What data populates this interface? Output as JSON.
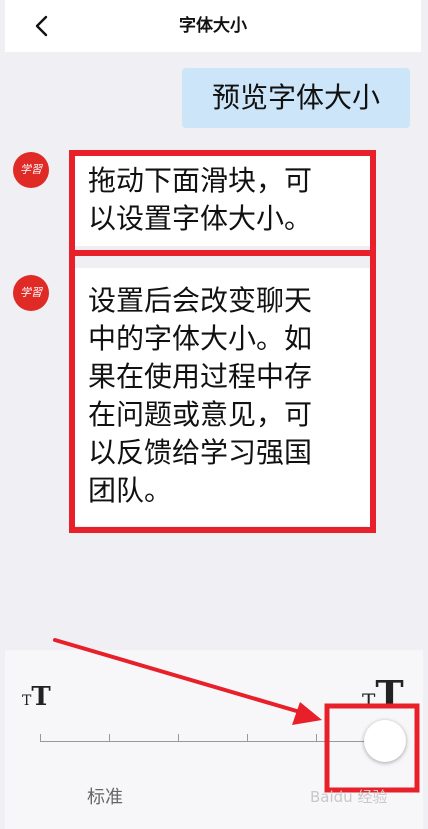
{
  "header": {
    "title": "字体大小",
    "back_icon": "chevron-left-icon"
  },
  "preview": {
    "text": "预览字体大小"
  },
  "messages": [
    {
      "avatar_text": "学習",
      "text_lines": [
        "拖动下面滑块，可",
        "以设置字体大小。"
      ]
    },
    {
      "avatar_text": "学習",
      "text_lines": [
        "设置后会改变聊天",
        "中的字体大小。如",
        "果在使用过程中存",
        "在问题或意见，可",
        "以反馈给学习强国",
        "团队。"
      ]
    }
  ],
  "slider": {
    "small_icon": "font-size-small-icon",
    "large_icon": "font-size-large-icon",
    "small_glyph_a": "T",
    "small_glyph_b": "T",
    "large_glyph_a": "T",
    "large_glyph_b": "T",
    "standard_label": "标准",
    "current_level": 6,
    "max_level": 6
  },
  "watermark": {
    "text": "Baidu 经验"
  },
  "colors": {
    "accent_red": "#e8202a",
    "preview_bubble": "#cce5f8",
    "avatar_red": "#e02a25"
  }
}
